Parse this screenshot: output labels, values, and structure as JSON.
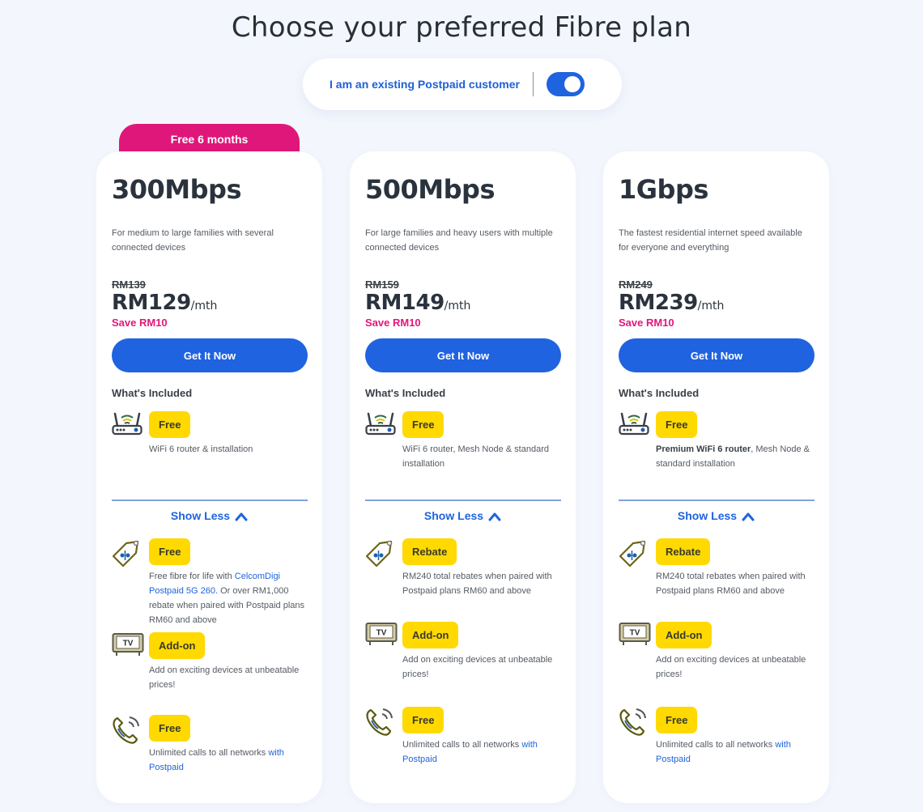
{
  "page": {
    "title": "Choose your preferred Fibre plan"
  },
  "toggle": {
    "label": "I am an existing Postpaid customer",
    "on": true,
    "accent": "#1f63e0"
  },
  "colors": {
    "primary": "#1f63e0",
    "highlight": "#e0177a",
    "badge": "#ffd900",
    "background": "#f3f6fd"
  },
  "plans": [
    {
      "ribbon": "Free 6 months",
      "speed": "300Mbps",
      "description": "For medium to large families with several connected devices",
      "old_price": "RM139",
      "price": "RM129",
      "per": "/mth",
      "save": "Save RM10",
      "cta": "Get It Now",
      "included_title": "What's Included",
      "router": {
        "icon": "router-icon",
        "badge": "Free",
        "text_bold": "",
        "text": "WiFi 6 router & installation"
      },
      "show_less": "Show Less",
      "rebate": {
        "icon": "price-tag-icon",
        "badge": "Free",
        "text_pre": "Free fibre for life with ",
        "text_link": "CelcomDigi Postpaid 5G 260.",
        "text_post": " Or over RM1,000 rebate when paired with Postpaid plans RM60 and above"
      },
      "addon": {
        "icon": "tv-icon",
        "badge": "Add-on",
        "text": "Add on exciting devices at unbeatable prices!"
      },
      "calls": {
        "icon": "phone-call-icon",
        "badge": "Free",
        "text": "Unlimited calls to all networks ",
        "text_link": "with Postpaid"
      }
    },
    {
      "ribbon": "",
      "speed": "500Mbps",
      "description": "For large families and heavy users with multiple connected devices",
      "old_price": "RM159",
      "price": "RM149",
      "per": "/mth",
      "save": "Save RM10",
      "cta": "Get It Now",
      "included_title": "What's Included",
      "router": {
        "icon": "router-icon",
        "badge": "Free",
        "text_bold": "",
        "text": "WiFi 6 router, Mesh Node & standard installation"
      },
      "show_less": "Show Less",
      "rebate": {
        "icon": "price-tag-icon",
        "badge": "Rebate",
        "text_pre": "RM240 total rebates when paired with Postpaid plans RM60 and above",
        "text_link": "",
        "text_post": ""
      },
      "addon": {
        "icon": "tv-icon",
        "badge": "Add-on",
        "text": "Add on exciting devices at unbeatable prices!"
      },
      "calls": {
        "icon": "phone-call-icon",
        "badge": "Free",
        "text": "Unlimited calls to all networks ",
        "text_link": "with Postpaid"
      }
    },
    {
      "ribbon": "",
      "speed": "1Gbps",
      "description": "The fastest residential internet speed available for everyone and everything",
      "old_price": "RM249",
      "price": "RM239",
      "per": "/mth",
      "save": "Save RM10",
      "cta": "Get It Now",
      "included_title": "What's Included",
      "router": {
        "icon": "router-icon",
        "badge": "Free",
        "text_bold": "Premium WiFi 6 router",
        "text": ", Mesh Node & standard installation"
      },
      "show_less": "Show Less",
      "rebate": {
        "icon": "price-tag-icon",
        "badge": "Rebate",
        "text_pre": "RM240 total rebates when paired with Postpaid plans RM60 and above",
        "text_link": "",
        "text_post": ""
      },
      "addon": {
        "icon": "tv-icon",
        "badge": "Add-on",
        "text": "Add on exciting devices at unbeatable prices!"
      },
      "calls": {
        "icon": "phone-call-icon",
        "badge": "Free",
        "text": "Unlimited calls to all networks ",
        "text_link": "with Postpaid"
      }
    }
  ]
}
